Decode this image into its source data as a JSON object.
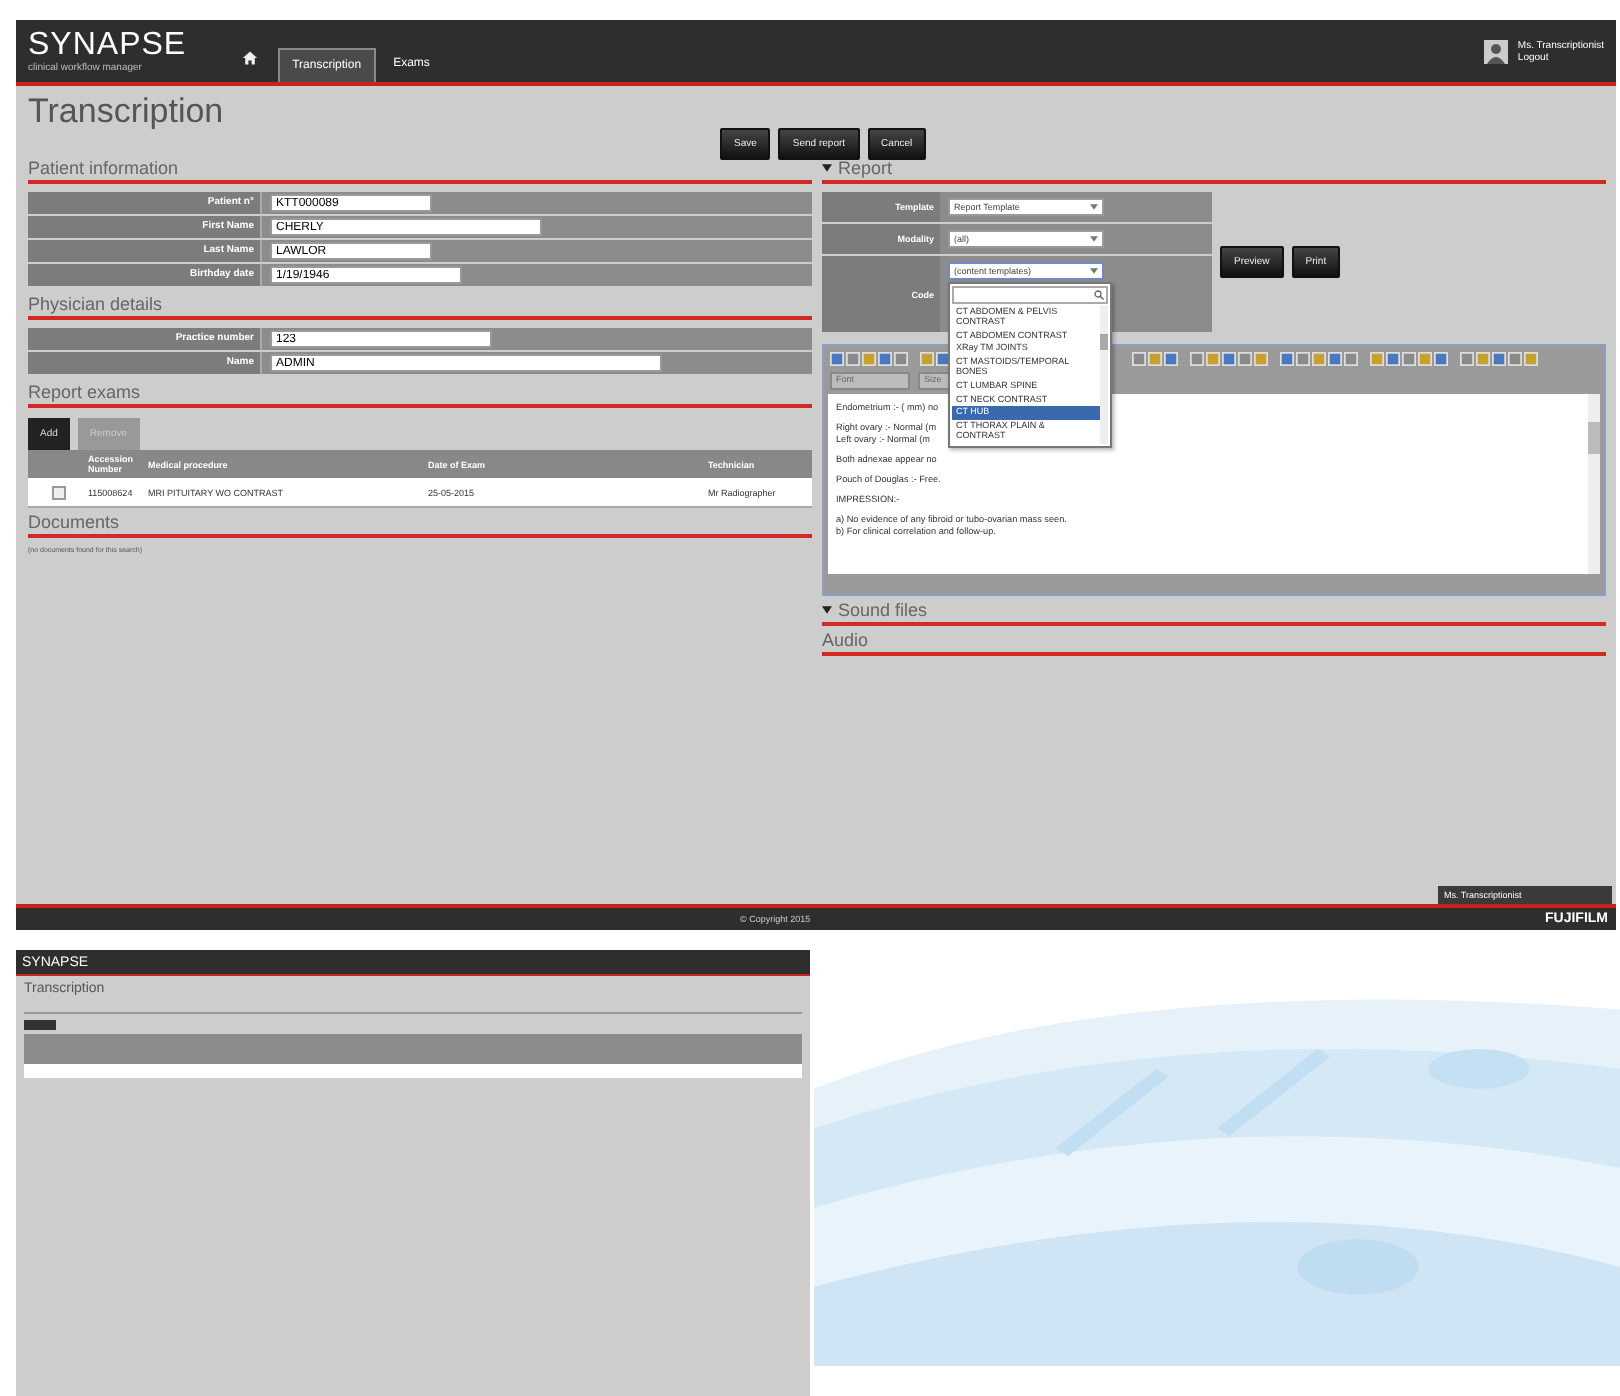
{
  "header": {
    "logo": "SYNAPSE",
    "logo_tagline": "clinical workflow manager",
    "tabs": [
      {
        "label": "Transcription",
        "selected": true
      },
      {
        "label": "Exams",
        "selected": false
      }
    ],
    "user": {
      "name": "Ms. Transcriptionist",
      "logout": "Logout"
    }
  },
  "page_title": "Transcription",
  "actions": [
    "Save",
    "Send report",
    "Cancel"
  ],
  "patient_information": {
    "title": "Patient information",
    "fields": [
      {
        "label": "Patient n°",
        "value": "KTT000089"
      },
      {
        "label": "First Name",
        "value": "CHERLY"
      },
      {
        "label": "Last Name",
        "value": "LAWLOR"
      },
      {
        "label": "Birthday date",
        "value": "1/19/1946"
      }
    ]
  },
  "physician_details": {
    "title": "Physician details",
    "fields": [
      {
        "label": "Practice number",
        "value": "123"
      },
      {
        "label": "Name",
        "value": "ADMIN"
      }
    ]
  },
  "report_exams": {
    "title": "Report exams",
    "buttons": [
      {
        "label": "Add",
        "disabled": false
      },
      {
        "label": "Remove",
        "disabled": true
      }
    ],
    "columns": [
      "Accession Number",
      "Medical procedure",
      "Date of Exam",
      "Technician"
    ],
    "rows": [
      {
        "checked": false,
        "cells": [
          "115008624",
          "MRI PITUITARY WO CONTRAST",
          "25-05-2015",
          "Mr Radiographer"
        ]
      }
    ]
  },
  "documents": {
    "title": "Documents",
    "empty_message": "(no documents found for this search)"
  },
  "report": {
    "title": "Report",
    "expanded": true,
    "template": {
      "label": "Template",
      "value": "Report Template"
    },
    "modality": {
      "label": "Modality",
      "value": "(all)"
    },
    "code": {
      "label": "Code",
      "value": "(content templates)",
      "open": true,
      "items": [
        {
          "label": "CT ABDOMEN & PELVIS CONTRAST",
          "selected": false
        },
        {
          "label": "CT ABDOMEN CONTRAST",
          "selected": false
        },
        {
          "label": "XRay TM JOINTS",
          "selected": false
        },
        {
          "label": "CT MASTOIDS/TEMPORAL BONES",
          "selected": false
        },
        {
          "label": "CT LUMBAR SPINE",
          "selected": false
        },
        {
          "label": "CT NECK CONTRAST",
          "selected": false
        },
        {
          "label": "CT HUB",
          "selected": true
        },
        {
          "label": "CT THORAX PLAIN & CONTRAST",
          "selected": false
        }
      ]
    },
    "buttons": [
      "Preview",
      "Print"
    ],
    "editor": {
      "font_placeholder": "Font",
      "size_placeholder": "Size",
      "paragraphs": [
        [
          "Endometrium :- ( mm) no"
        ],
        [
          "Right ovary :- Normal (m",
          "Left ovary :- Normal (m"
        ],
        [
          "Both adnexae appear no"
        ],
        [
          "Pouch of Douglas :- Free."
        ],
        [
          "IMPRESSION:-"
        ],
        [
          "a) No evidence of any fibroid or tubo-ovarian mass seen.",
          "b) For clinical correlation and follow-up."
        ]
      ]
    }
  },
  "sound_files": {
    "title": "Sound files",
    "expanded": true
  },
  "audio": {
    "title": "Audio"
  },
  "footer": {
    "copyright": "© Copyright 2015",
    "brand": "FUJIFILM",
    "chat": "Ms. Transcriptionist"
  },
  "preview_screen": {
    "logo": "SYNAPSE",
    "title": "Transcription"
  }
}
